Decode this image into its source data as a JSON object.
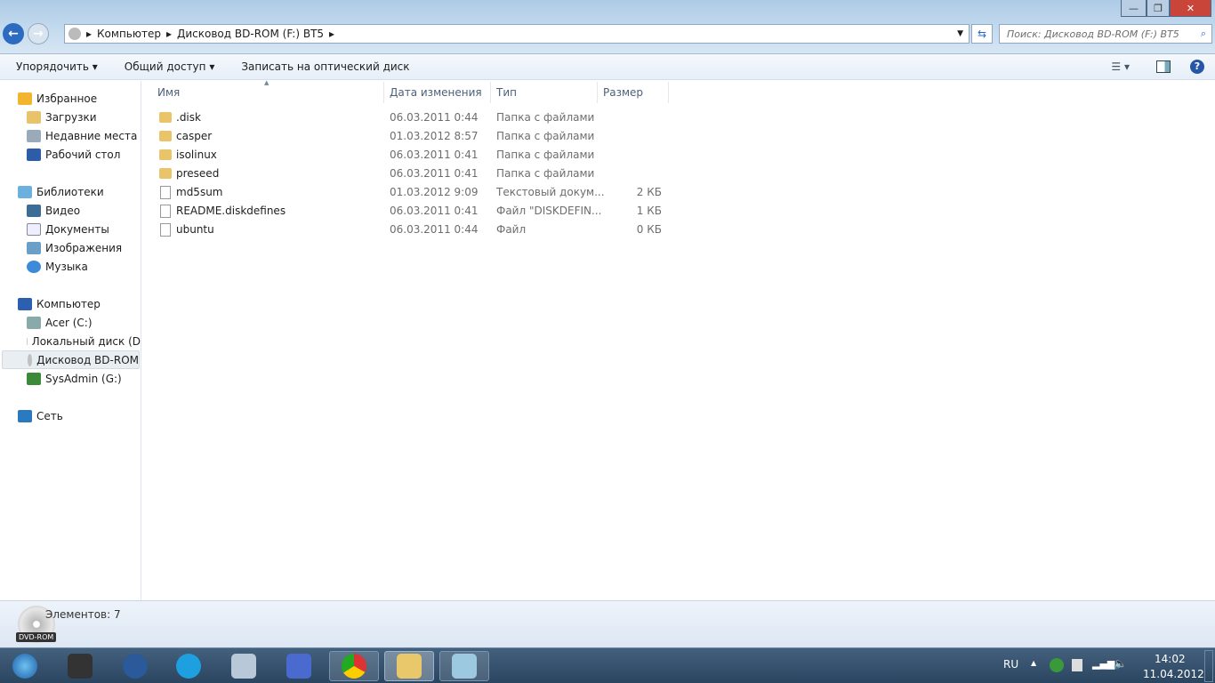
{
  "window": {
    "minimize": "—",
    "maximize": "❐",
    "close": "✕"
  },
  "address": {
    "crumbs": [
      "Компьютер",
      "Дисковод BD-ROM (F:) BT5"
    ],
    "search_placeholder": "Поиск: Дисковод BD-ROM (F:) BT5"
  },
  "toolbar": {
    "organize": "Упорядочить ▾",
    "share": "Общий доступ ▾",
    "burn": "Записать на оптический диск"
  },
  "sidebar": {
    "favorites": "Избранное",
    "downloads": "Загрузки",
    "recent": "Недавние места",
    "desktop": "Рабочий стол",
    "libraries": "Библиотеки",
    "video": "Видео",
    "documents": "Документы",
    "images": "Изображения",
    "music": "Музыка",
    "computer": "Компьютер",
    "c": "Acer (C:)",
    "d": "Локальный диск (D",
    "f": "Дисковод BD-ROM",
    "g": "SysAdmin (G:)",
    "network": "Сеть"
  },
  "columns": {
    "name": "Имя",
    "date": "Дата изменения",
    "type": "Тип",
    "size": "Размер"
  },
  "files": [
    {
      "name": ".disk",
      "date": "06.03.2011 0:44",
      "type": "Папка с файлами",
      "size": "",
      "kind": "folder"
    },
    {
      "name": "casper",
      "date": "01.03.2012 8:57",
      "type": "Папка с файлами",
      "size": "",
      "kind": "folder"
    },
    {
      "name": "isolinux",
      "date": "06.03.2011 0:41",
      "type": "Папка с файлами",
      "size": "",
      "kind": "folder"
    },
    {
      "name": "preseed",
      "date": "06.03.2011 0:41",
      "type": "Папка с файлами",
      "size": "",
      "kind": "folder"
    },
    {
      "name": "md5sum",
      "date": "01.03.2012 9:09",
      "type": "Текстовый докум...",
      "size": "2 КБ",
      "kind": "file"
    },
    {
      "name": "README.diskdefines",
      "date": "06.03.2011 0:41",
      "type": "Файл \"DISKDEFIN...",
      "size": "1 КБ",
      "kind": "file"
    },
    {
      "name": "ubuntu",
      "date": "06.03.2011 0:44",
      "type": "Файл",
      "size": "0 КБ",
      "kind": "file"
    }
  ],
  "status": {
    "count": "Элементов: 7",
    "drive_label": "DVD-ROM"
  },
  "tray": {
    "lang": "RU",
    "time": "14:02",
    "date": "11.04.2012"
  }
}
